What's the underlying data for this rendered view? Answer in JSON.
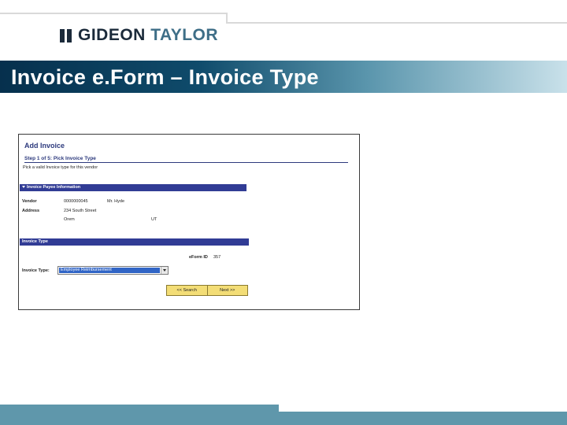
{
  "logo": {
    "text_main": "GIDEON ",
    "text_accent": "TAYLOR"
  },
  "slide_title": "Invoice e.Form – Invoice Type",
  "form": {
    "page_title": "Add Invoice",
    "step_title": "Step 1 of 5: Pick  Invoice Type",
    "instruction": "Pick a valid Invoice type for this vendor",
    "payee_section": {
      "title": "Invoice Payee Information",
      "vendor_label": "Vendor",
      "vendor_id": "0000000045",
      "vendor_name": "Mr. Hyde",
      "address_label": "Address",
      "address_line1": "234 South Street",
      "city": "Orem",
      "state": "UT"
    },
    "type_section": {
      "title": "Invoice Type",
      "eform_id_label": "eForm ID",
      "eform_id_value": "357",
      "invoice_type_label": "Invoice Type:",
      "invoice_type_selected": "Employee Reimbursement"
    },
    "buttons": {
      "search": "<< Search",
      "next": "Next >>"
    }
  },
  "colors": {
    "title_bar_start": "#06304d",
    "section_bar": "#313c95",
    "button_bg": "#f3dd76",
    "footer": "#5f97ab"
  }
}
